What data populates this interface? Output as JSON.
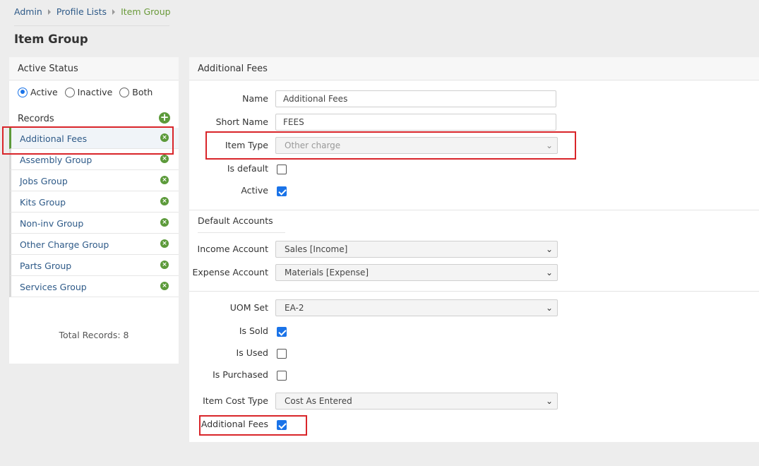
{
  "breadcrumb": [
    {
      "label": "Admin"
    },
    {
      "label": "Profile Lists"
    },
    {
      "label": "Item Group"
    }
  ],
  "page_title": "Item Group",
  "left_panel": {
    "header": "Active Status",
    "radio_options": [
      {
        "label": "Active",
        "checked": true
      },
      {
        "label": "Inactive",
        "checked": false
      },
      {
        "label": "Both",
        "checked": false
      }
    ],
    "records_label": "Records",
    "records": [
      "Additional Fees",
      "Assembly Group",
      "Jobs Group",
      "Kits Group",
      "Non-inv Group",
      "Other Charge Group",
      "Parts Group",
      "Services Group"
    ],
    "selected_record": "Additional Fees",
    "total_records": "Total Records: 8"
  },
  "form": {
    "header": "Additional Fees",
    "name_label": "Name",
    "name_value": "Additional Fees",
    "short_name_label": "Short Name",
    "short_name_value": "FEES",
    "item_type_label": "Item Type",
    "item_type_value": "Other charge",
    "is_default_label": "Is default",
    "is_default_checked": false,
    "active_label": "Active",
    "active_checked": true,
    "default_accounts_title": "Default Accounts",
    "income_account_label": "Income Account",
    "income_account_value": "Sales [Income]",
    "expense_account_label": "Expense Account",
    "expense_account_value": "Materials [Expense]",
    "uom_set_label": "UOM Set",
    "uom_set_value": "EA-2",
    "is_sold_label": "Is Sold",
    "is_sold_checked": true,
    "is_used_label": "Is Used",
    "is_used_checked": false,
    "is_purchased_label": "Is Purchased",
    "is_purchased_checked": false,
    "item_cost_type_label": "Item Cost Type",
    "item_cost_type_value": "Cost As Entered",
    "additional_fees_label": "Additional Fees",
    "additional_fees_checked": true
  },
  "colors": {
    "link": "#2e5a88",
    "breadcrumb_current": "#6a9a3a",
    "accent_green": "#5c9a3a",
    "checkbox_blue": "#1a73e8",
    "highlight_red": "#d9252a"
  }
}
